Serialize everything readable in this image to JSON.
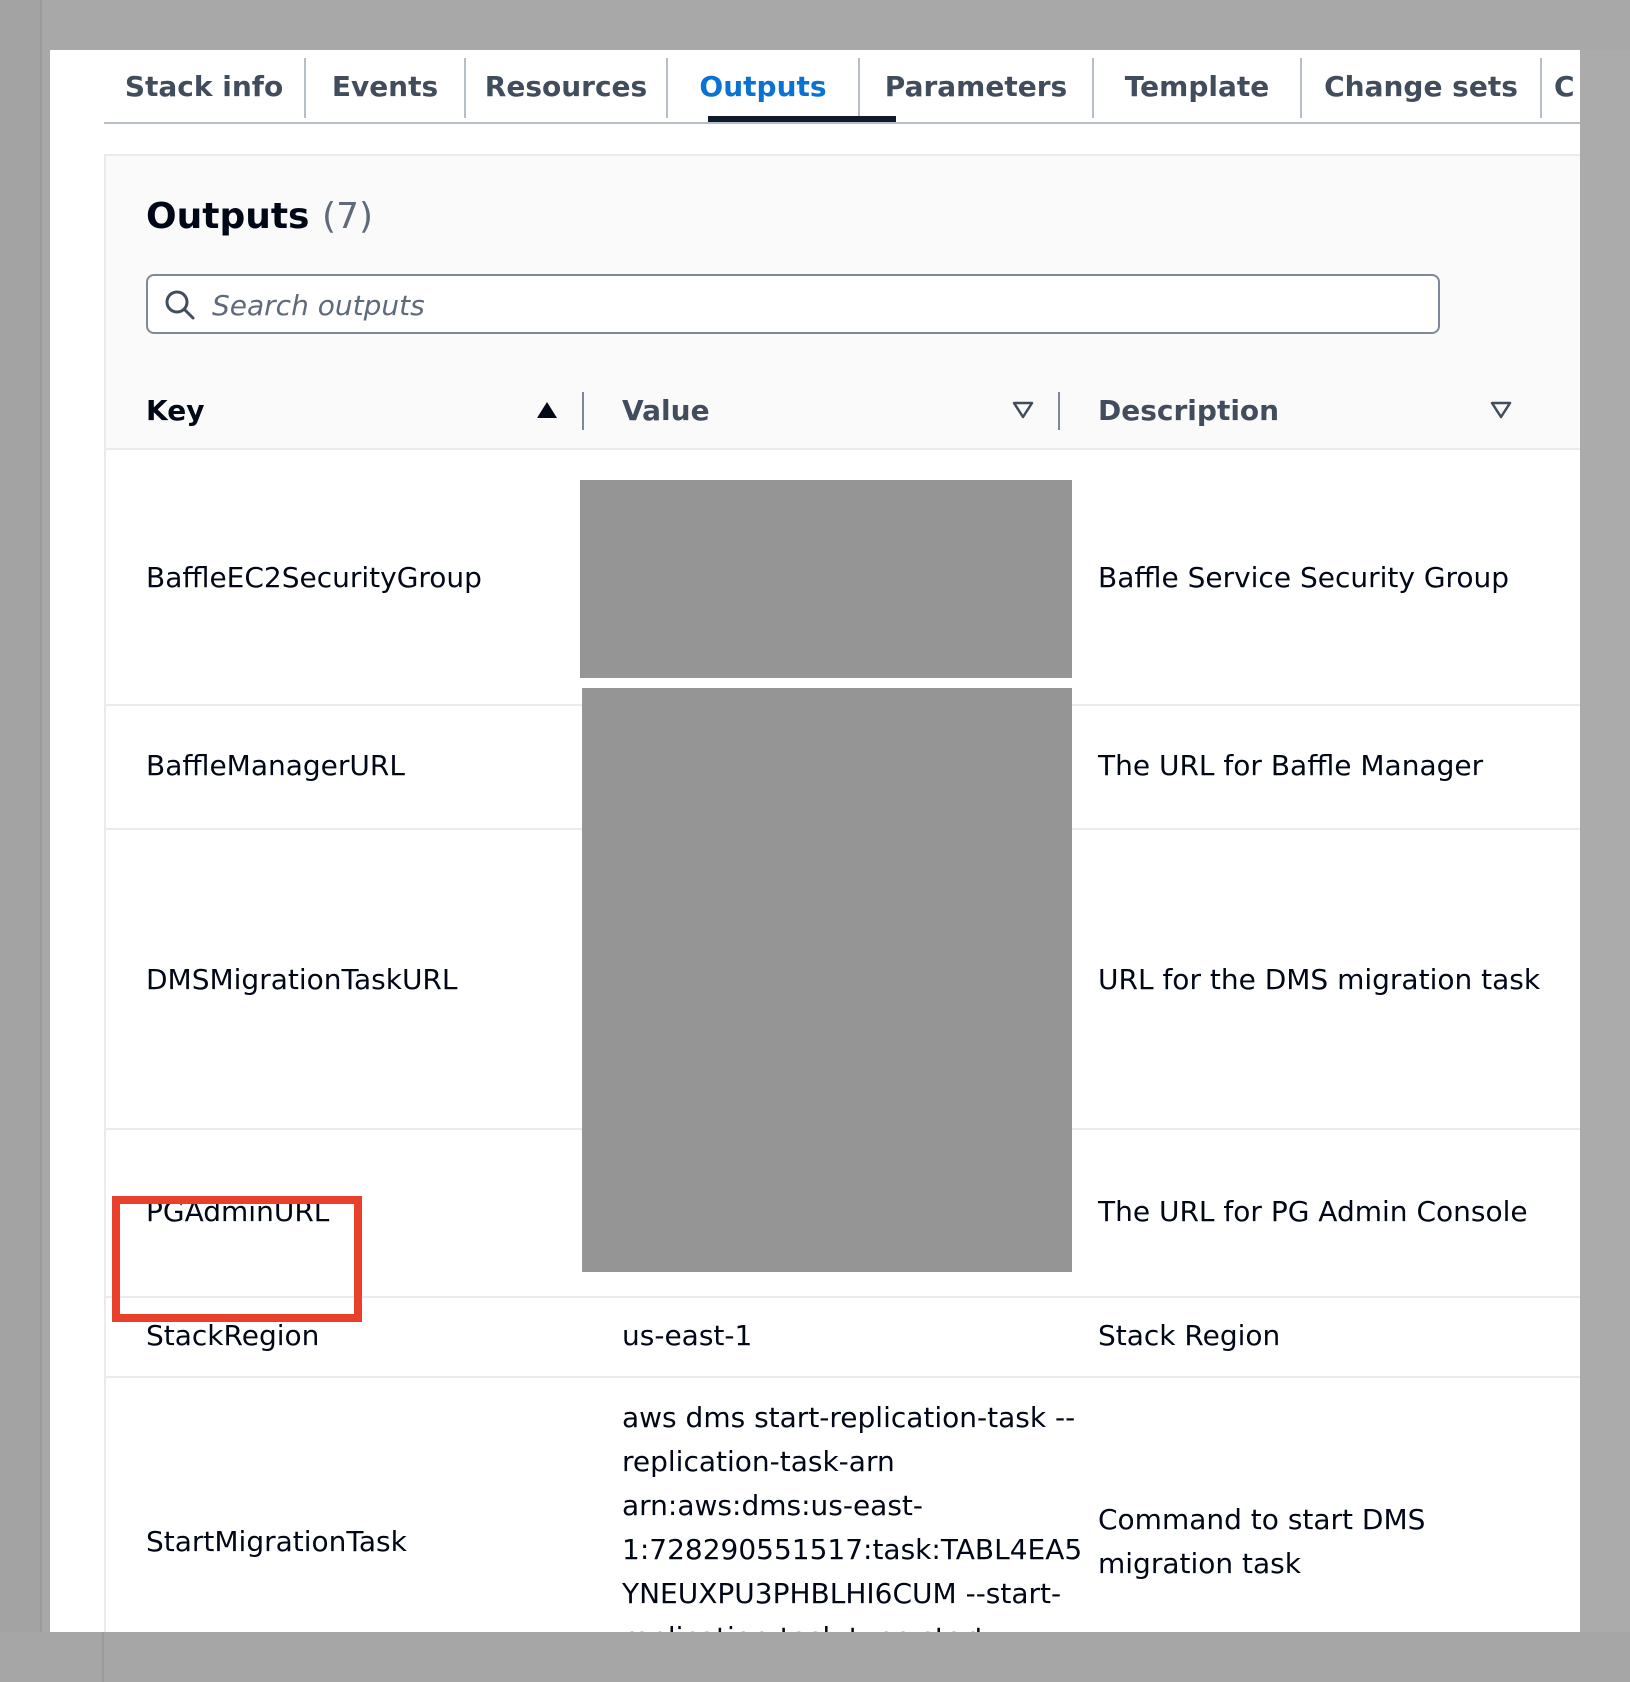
{
  "tabs": [
    "Stack info",
    "Events",
    "Resources",
    "Outputs",
    "Parameters",
    "Template",
    "Change sets",
    "C"
  ],
  "active_tab": "Outputs",
  "outputs": {
    "title": "Outputs",
    "count": "(7)",
    "search_placeholder": "Search outputs",
    "columns": {
      "key": "Key",
      "value": "Value",
      "description": "Description"
    },
    "rows": [
      {
        "key": "BaffleEC2SecurityGroup",
        "value": "",
        "description": "Baffle Service Security Group"
      },
      {
        "key": "BaffleManagerURL",
        "value": "",
        "description": "The URL for Baffle Manager"
      },
      {
        "key": "DMSMigrationTaskURL",
        "value": "",
        "description": "URL for the DMS migration task"
      },
      {
        "key": "PGAdminURL",
        "value": "",
        "description": "The URL for PG Admin Console"
      },
      {
        "key": "StackRegion",
        "value": "us-east-1",
        "description": "Stack Region"
      },
      {
        "key": "StartMigrationTask",
        "value": "aws dms start-replication-task --\nreplication-task-arn\narn:aws:dms:us-east-\n1:728290551517:task:TABL4EA5\nYNEUXPU3PHBLHI6CUM --start-\nreplication-task-type start-\nreplication",
        "description": "Command to start DMS\nmigration task"
      }
    ]
  },
  "icons": {
    "search": "search-icon",
    "sort_asc": "sort-ascending-icon",
    "sort_none": "sort-descending-icon",
    "grip": "resize-handle-icon"
  },
  "colors": {
    "accent": "#0972d3",
    "highlight": "#e8402b",
    "redaction": "#959595"
  }
}
